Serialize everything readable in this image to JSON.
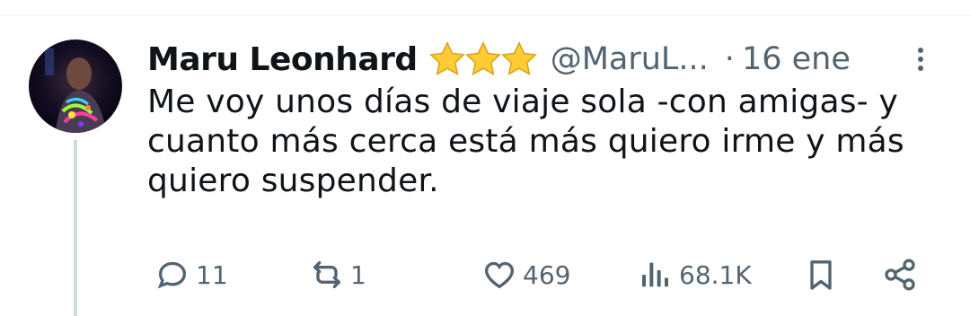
{
  "tweet": {
    "author_name": "Maru Leonhard",
    "handle": "@MaruL...",
    "separator": "·",
    "timestamp": "16 ene",
    "badge_icons": [
      "star-icon",
      "star-icon",
      "star-icon"
    ],
    "text": "Me voy unos días de viaje sola -con amigas- y cuanto más cerca está más quiero irme y más quiero suspender."
  },
  "actions": {
    "replies": "11",
    "reposts": "1",
    "likes": "469",
    "views": "68.1K"
  },
  "colors": {
    "text": "#0f1419",
    "muted": "#536471",
    "star": "#ffcc33"
  }
}
